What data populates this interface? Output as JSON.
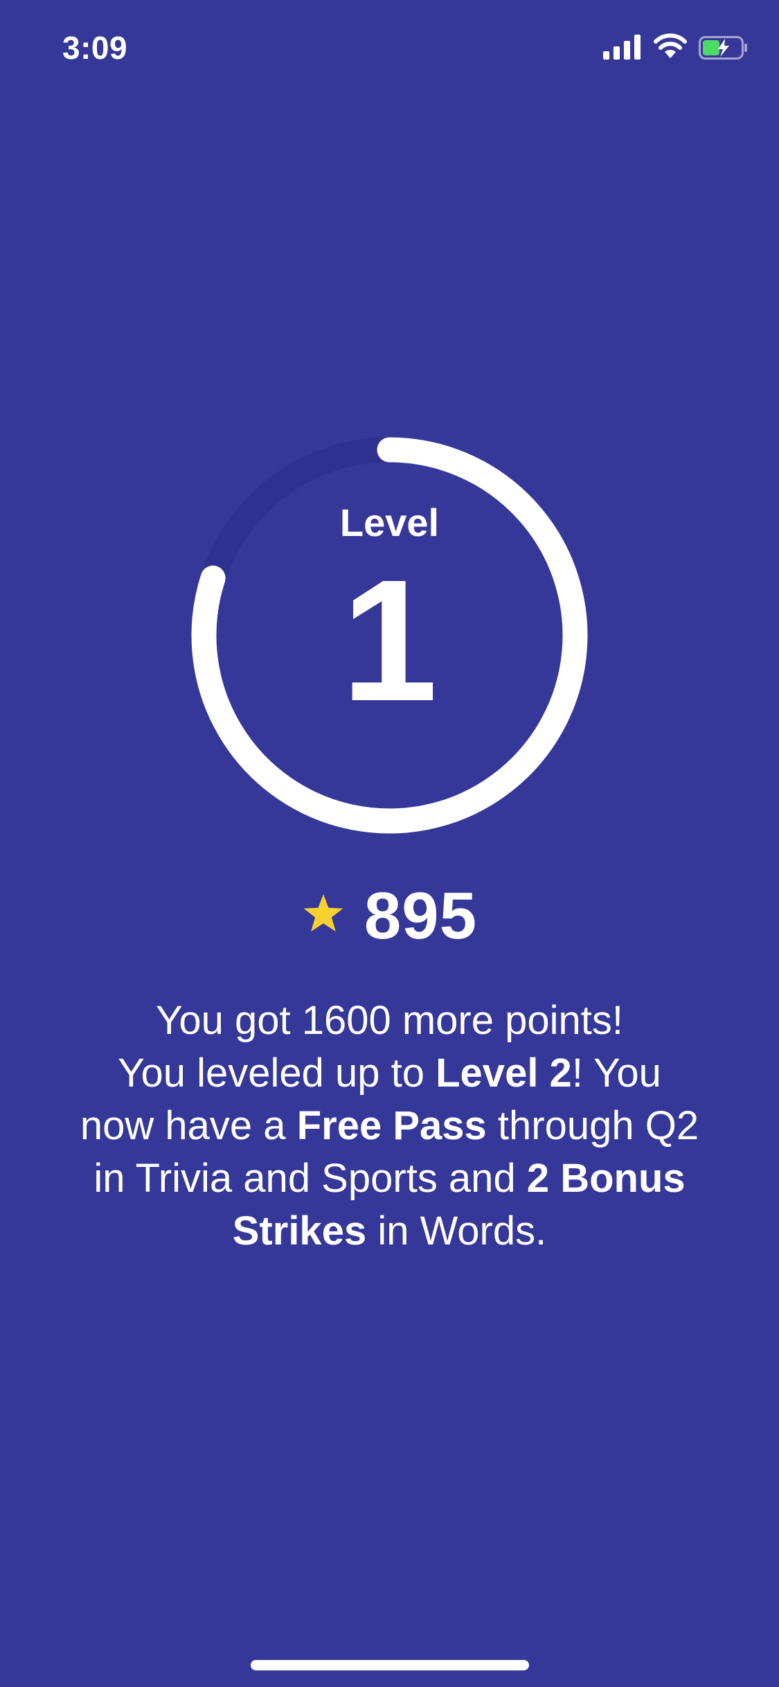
{
  "status_bar": {
    "time": "3:09"
  },
  "level": {
    "label": "Level",
    "number": "1",
    "progress": 0.8
  },
  "points": {
    "value": "895",
    "icon": "star-icon"
  },
  "message": {
    "line1": "You got 1600 more points!",
    "line2_prefix": "You leveled up to ",
    "line2_bold": "Level 2",
    "line2_suffix": "! You",
    "line3_prefix": "now have a ",
    "line3_bold": "Free Pass",
    "line3_suffix": " through Q2",
    "line4_prefix": "in Trivia and Sports and ",
    "line4_bold": "2 Bonus",
    "line5_bold": "Strikes",
    "line5_suffix": " in Words."
  },
  "colors": {
    "background": "#363899",
    "ring_track": "#2F3190",
    "ring_progress": "#FFFFFF",
    "star": "#F8D12F",
    "battery_fill": "#4CD964"
  }
}
